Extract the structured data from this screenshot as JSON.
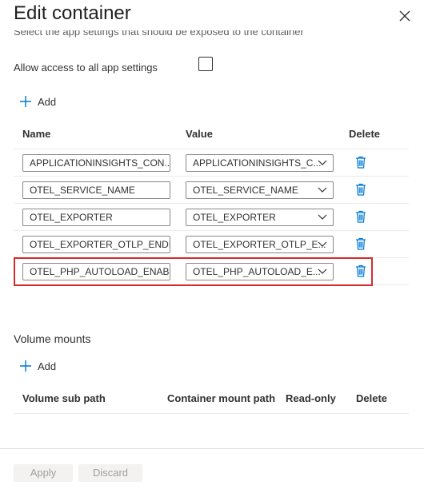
{
  "dialog": {
    "title": "Edit container"
  },
  "cutoff_text": "Select the app settings that should be exposed to the container",
  "allow_access": {
    "label": "Allow access to all app settings",
    "checked": false
  },
  "env": {
    "add_label": "Add",
    "headers": {
      "name": "Name",
      "value": "Value",
      "delete": "Delete"
    },
    "rows": [
      {
        "name": "APPLICATIONINSIGHTS_CON...",
        "value": "APPLICATIONINSIGHTS_C..."
      },
      {
        "name": "OTEL_SERVICE_NAME",
        "value": "OTEL_SERVICE_NAME"
      },
      {
        "name": "OTEL_EXPORTER",
        "value": "OTEL_EXPORTER"
      },
      {
        "name": "OTEL_EXPORTER_OTLP_ENDP...",
        "value": "OTEL_EXPORTER_OTLP_E..."
      },
      {
        "name": "OTEL_PHP_AUTOLOAD_ENABL...",
        "value": "OTEL_PHP_AUTOLOAD_E...",
        "highlighted": true
      }
    ]
  },
  "volume": {
    "title": "Volume mounts",
    "add_label": "Add",
    "headers": {
      "sub_path": "Volume sub path",
      "mount_path": "Container mount path",
      "read_only": "Read-only",
      "delete": "Delete"
    }
  },
  "footer": {
    "apply": "Apply",
    "discard": "Discard"
  },
  "colors": {
    "accent": "#0078d4",
    "highlight": "#d62b2b",
    "disabled_bg": "#f3f2f1",
    "disabled_text": "#a19f9d"
  }
}
